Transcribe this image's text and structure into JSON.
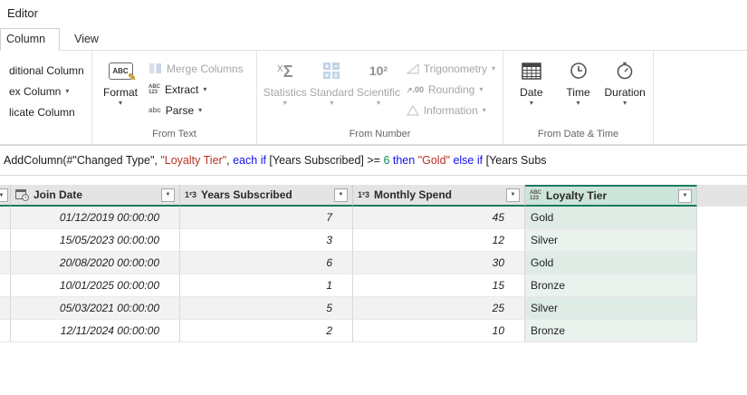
{
  "colors": {
    "accent": "#1b7a5e",
    "sel-header-bg": "#cde4d8",
    "sel-cell": "#e9f2ed",
    "sel-cell-alt": "#dfebe5",
    "tok-string": "#b63325",
    "tok-keyword": "#1111ee",
    "tok-number": "#0e8662"
  },
  "window": {
    "title": "Editor"
  },
  "tabs": {
    "column": "Column",
    "view": "View"
  },
  "ribbon": {
    "left_items": {
      "item1": "ditional Column",
      "item2": "ex Column",
      "item3": "licate Column"
    },
    "from_text": {
      "group_label": "From Text",
      "format": "Format",
      "merge_columns": "Merge Columns",
      "extract": "Extract",
      "parse": "Parse"
    },
    "from_number": {
      "group_label": "From Number",
      "statistics": "Statistics",
      "standard": "Standard",
      "scientific": "Scientific",
      "trigonometry": "Trigonometry",
      "rounding": "Rounding",
      "information": "Information"
    },
    "from_datetime": {
      "group_label": "From Date & Time",
      "date": "Date",
      "time": "Time",
      "duration": "Duration"
    }
  },
  "icons": {
    "dropdown": "▾",
    "filter_arrow": "▼",
    "format_glyph": "ABC",
    "pencil": "✎",
    "statistics_chi": "Χ",
    "statistics_sigma": "Σ",
    "scientific_glyph": "10²",
    "extract_top": "ABC",
    "extract_bottom": "123",
    "parse_glyph": "abc",
    "rounding_glyph": ".00",
    "rounding_arrow": "↗",
    "numeric_type": "1²3",
    "text_type_top": "ABC",
    "text_type_bottom": "123"
  },
  "formula": {
    "tokens": [
      {
        "t": "AddColumn(#\"Changed Type\", ",
        "c": "plain"
      },
      {
        "t": "\"Loyalty Tier\"",
        "c": "string"
      },
      {
        "t": ", ",
        "c": "plain"
      },
      {
        "t": "each ",
        "c": "keyword"
      },
      {
        "t": "if ",
        "c": "keyword"
      },
      {
        "t": "[Years Subscribed] >= ",
        "c": "plain"
      },
      {
        "t": "6 ",
        "c": "number"
      },
      {
        "t": "then ",
        "c": "keyword"
      },
      {
        "t": "\"Gold\" ",
        "c": "string"
      },
      {
        "t": "else ",
        "c": "keyword"
      },
      {
        "t": "if ",
        "c": "keyword"
      },
      {
        "t": "[Years Subs",
        "c": "plain"
      }
    ]
  },
  "table": {
    "headers": {
      "join_date": "Join Date",
      "years": "Years Subscribed",
      "spend": "Monthly Spend",
      "tier": "Loyalty Tier"
    },
    "rows": [
      {
        "join_date": "01/12/2019 00:00:00",
        "years": "7",
        "spend": "45",
        "tier": "Gold"
      },
      {
        "join_date": "15/05/2023 00:00:00",
        "years": "3",
        "spend": "12",
        "tier": "Silver"
      },
      {
        "join_date": "20/08/2020 00:00:00",
        "years": "6",
        "spend": "30",
        "tier": "Gold"
      },
      {
        "join_date": "10/01/2025 00:00:00",
        "years": "1",
        "spend": "15",
        "tier": "Bronze"
      },
      {
        "join_date": "05/03/2021 00:00:00",
        "years": "5",
        "spend": "25",
        "tier": "Silver"
      },
      {
        "join_date": "12/11/2024 00:00:00",
        "years": "2",
        "spend": "10",
        "tier": "Bronze"
      }
    ]
  }
}
